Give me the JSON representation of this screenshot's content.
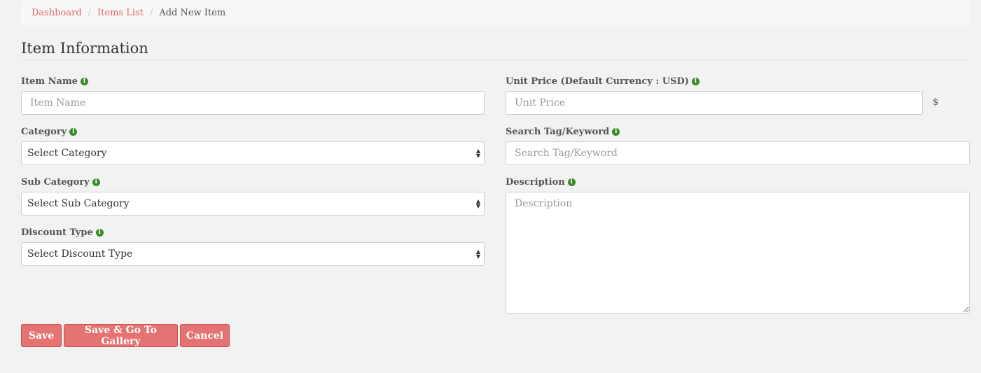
{
  "breadcrumb": {
    "items": [
      "Dashboard",
      "Items List"
    ],
    "current": "Add New Item",
    "separator": "/"
  },
  "section": {
    "title": "Item Information"
  },
  "fields": {
    "item_name": {
      "label": "Item Name",
      "placeholder": "Item Name"
    },
    "category": {
      "label": "Category",
      "selected": "Select Category"
    },
    "sub_category": {
      "label": "Sub Category",
      "selected": "Select Sub Category"
    },
    "discount_type": {
      "label": "Discount Type",
      "selected": "Select Discount Type"
    },
    "unit_price": {
      "label": "Unit Price (Default Currency : USD)",
      "placeholder": "Unit Price",
      "currency_symbol": "$"
    },
    "search_tag": {
      "label": "Search Tag/Keyword",
      "placeholder": "Search Tag/Keyword"
    },
    "description": {
      "label": "Description",
      "placeholder": "Description"
    }
  },
  "icons": {
    "info": "info-icon",
    "info_glyph": "i",
    "select_up": "▲",
    "select_down": "▼"
  },
  "buttons": {
    "save": "Save",
    "save_gallery": "Save & Go To Gallery",
    "cancel": "Cancel"
  },
  "colors": {
    "accent": "#e57373",
    "link": "#e06666",
    "info_icon": "#3a8a2a"
  }
}
